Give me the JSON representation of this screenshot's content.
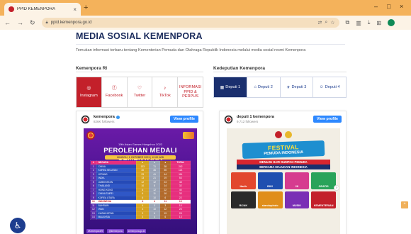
{
  "browser": {
    "tab_title": "PPID KEMENPORA",
    "new_tab": "+",
    "close_tab": "×",
    "url": "ppid.kemenpora.go.id",
    "win_min": "–",
    "win_max": "□",
    "win_close": "×"
  },
  "page": {
    "heading": "MEDIA SOSIAL KEMENPORA",
    "description": "Temukan informasi terbaru tentang Kementerian Pemuda dan Olahraga Republik Indonesia melalui media sosial resmi Kemenpora"
  },
  "left": {
    "title": "Kemenpora RI",
    "tabs": [
      {
        "label": "Instagram",
        "icon": "instagram-icon"
      },
      {
        "label": "Facebook",
        "icon": "facebook-icon"
      },
      {
        "label": "Twitter",
        "icon": "twitter-icon"
      },
      {
        "label": "TikTok",
        "icon": "tiktok-icon"
      },
      {
        "label": "INFORMASI PPID & PERPUS",
        "icon": "info"
      }
    ],
    "card": {
      "username": "kemenpora",
      "followers": "826K followers",
      "view_profile": "View profile"
    },
    "post": {
      "event": "19th Asian Games Hangzhou 2022",
      "title": "PEROLEHAN MEDALI SEMENTARA",
      "date": "MINGGU, 1 OKTOBER 2023 | 12.00 WIB",
      "headers": [
        "#",
        "NEGARA",
        "",
        "",
        "",
        "TOTAL"
      ],
      "rows": [
        [
          "1",
          "CHINA",
          "133",
          "71",
          "38",
          "242"
        ],
        [
          "2",
          "KOREA SELATAN",
          "30",
          "36",
          "55",
          "121"
        ],
        [
          "3",
          "JEPANG",
          "29",
          "41",
          "44",
          "114"
        ],
        [
          "4",
          "INDIA",
          "13",
          "21",
          "19",
          "53"
        ],
        [
          "5",
          "UZBEKISTAN",
          "12",
          "12",
          "24",
          "48"
        ],
        [
          "6",
          "THAILAND",
          "10",
          "8",
          "14",
          "32"
        ],
        [
          "7",
          "HONG KONG",
          "6",
          "12",
          "22",
          "40"
        ],
        [
          "8",
          "CHINA TAIPEI",
          "6",
          "11",
          "16",
          "33"
        ],
        [
          "9",
          "KOREA UTARA",
          "6",
          "10",
          "6",
          "22"
        ],
        [
          "10",
          "INDONESIA",
          "4",
          "4",
          "11",
          "19"
        ],
        [
          "11",
          "BAHRAIN",
          "4",
          "3",
          "3",
          "10"
        ],
        [
          "12",
          "IRAN",
          "3",
          "10",
          "12",
          "25"
        ],
        [
          "13",
          "KAZAKHSTAN",
          "3",
          "6",
          "19",
          "28"
        ],
        [
          "14",
          "MALAYSIA",
          "3",
          "4",
          "6",
          "13"
        ]
      ],
      "footer": [
        "#KemenporaRI",
        "@kemenpora",
        "kemenpora.go.id"
      ]
    }
  },
  "right": {
    "title": "Kedeputian Kemenpora",
    "tabs": [
      {
        "label": "Deputi 1",
        "icon": "chart-icon"
      },
      {
        "label": "Deputi 2",
        "icon": "home-icon"
      },
      {
        "label": "Deputi 3",
        "icon": "run-icon"
      },
      {
        "label": "Deputi 4",
        "icon": "people-icon"
      }
    ],
    "card": {
      "username": "deputi 1 kemenpora",
      "followers": "9,712 followers",
      "view_profile": "View profile"
    },
    "post": {
      "festival_1": "FESTIVAL",
      "festival_2": "PEMUDA",
      "festival_3": "INDONESIA",
      "tag1": "MENUJU HARI SUMPAH PEMUDA",
      "tag2": "BERSAMA MAJUKAN INDONESIA",
      "tiles": [
        {
          "label": "Hadir",
          "color": "#e2472d"
        },
        {
          "label": "BIG!",
          "color": "#1f4fb0"
        },
        {
          "label": "28",
          "color": "#d63c8f"
        },
        {
          "label": "GRATIS",
          "color": "#29a35a"
        },
        {
          "label": "BIJAK",
          "color": "#2a2a2a"
        },
        {
          "label": "standupindo",
          "color": "#e08e1a"
        },
        {
          "label": "MUSIK",
          "color": "#7a2fb5"
        },
        {
          "label": "KEMENTERIAN",
          "color": "#c3202a"
        }
      ]
    }
  },
  "colors": {
    "brand_red": "#c3202a",
    "brand_navy": "#1a2f6e",
    "chrome_orange": "#f4b25b"
  }
}
